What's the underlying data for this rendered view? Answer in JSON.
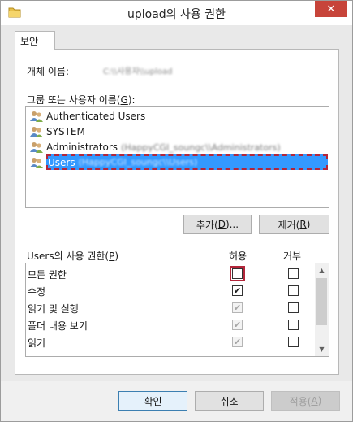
{
  "window": {
    "title": "upload의 사용 권한",
    "close_glyph": "✕"
  },
  "tabs": [
    {
      "label": "보안"
    }
  ],
  "object": {
    "label": "개체 이름:",
    "value": "C:\\\\사용자\\\\upload"
  },
  "groups": {
    "label_prefix": "그룹 또는 사용자 이름(",
    "label_mnemonic": "G",
    "label_suffix": "):",
    "items": [
      {
        "name": "Authenticated Users",
        "detail": ""
      },
      {
        "name": "SYSTEM",
        "detail": ""
      },
      {
        "name": "Administrators",
        "detail": "(HappyCGI_soungc\\\\Administrators)"
      },
      {
        "name": "Users",
        "detail": "(HappyCGI_soungc\\\\Users)"
      }
    ],
    "selected_index": 3
  },
  "buttons": {
    "add_label": "추가(",
    "add_mnemonic": "D",
    "add_suffix": ")...",
    "remove_label": "제거(",
    "remove_mnemonic": "R",
    "remove_suffix": ")",
    "ok": "확인",
    "cancel": "취소",
    "apply_label": "적용(",
    "apply_mnemonic": "A",
    "apply_suffix": ")"
  },
  "permissions": {
    "header_prefix": "Users의 사용 권한(",
    "header_mnemonic": "P",
    "header_suffix": ")",
    "allow_header": "허용",
    "deny_header": "거부",
    "check_glyph": "✔",
    "rows": [
      {
        "name": "모든 권한",
        "allow": false,
        "deny": false,
        "allow_grayed": false,
        "highlighted": true
      },
      {
        "name": "수정",
        "allow": true,
        "deny": false,
        "allow_grayed": false,
        "highlighted": false
      },
      {
        "name": "읽기 및 실행",
        "allow": true,
        "deny": false,
        "allow_grayed": true,
        "highlighted": false
      },
      {
        "name": "폴더 내용 보기",
        "allow": true,
        "deny": false,
        "allow_grayed": true,
        "highlighted": false
      },
      {
        "name": "읽기",
        "allow": true,
        "deny": false,
        "allow_grayed": true,
        "highlighted": false
      }
    ]
  },
  "scrollbar": {
    "up_glyph": "▲",
    "down_glyph": "▼"
  },
  "colors": {
    "selection": "#3399ff",
    "highlight_outline": "#b3263a",
    "close_button": "#c7443a"
  }
}
